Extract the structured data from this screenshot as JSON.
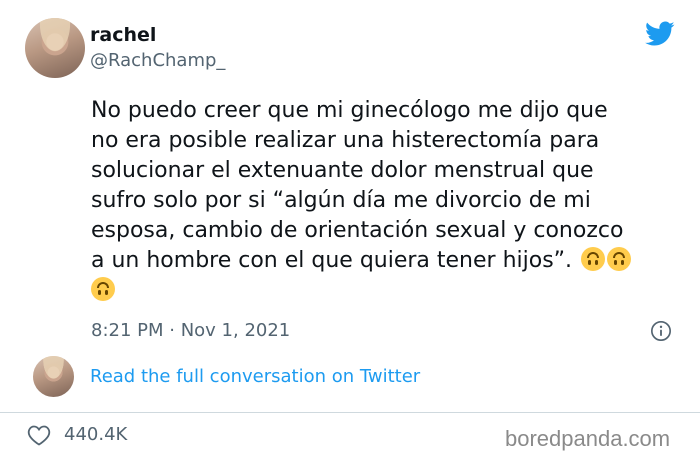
{
  "author": {
    "name": "rachel",
    "handle": "@RachChamp_"
  },
  "tweet": {
    "lines": [
      "No puedo creer que mi ginecólogo me dijo que",
      "no era posible realizar una histerectomía para",
      "solucionar el extenuante dolor menstrual que",
      "sufro solo por si “algún día me divorcio de mi",
      "esposa, cambio de orientación sexual y conozco",
      "a un hombre con el que quiera tener hijos”."
    ],
    "emoji": "upside-down-face",
    "timestamp": "8:21 PM · Nov 1, 2021"
  },
  "conversation_link": "Read the full conversation on Twitter",
  "likes": "440.4K",
  "watermark": "boredpanda.com",
  "colors": {
    "link": "#1d9bf0",
    "secondary_text": "#536471",
    "twitter_blue": "#1d9bf0"
  }
}
